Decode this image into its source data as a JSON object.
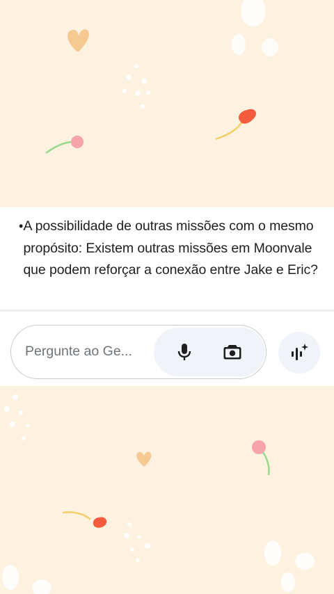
{
  "message": {
    "bullet": "•",
    "text": "A possibilidade de outras missões com o mesmo propósito: Existem outras missões em Moonvale que podem reforçar a conexão entre Jake e Eric?"
  },
  "input": {
    "placeholder": "Pergunte ao Ge..."
  },
  "icons": {
    "mic": "microphone-icon",
    "camera": "camera-icon",
    "live": "gemini-live-icon"
  },
  "colors": {
    "background": "#fdf1df",
    "text": "#1f1f1f",
    "placeholder": "#6f7478",
    "tool_bg": "#f0f3f8"
  }
}
